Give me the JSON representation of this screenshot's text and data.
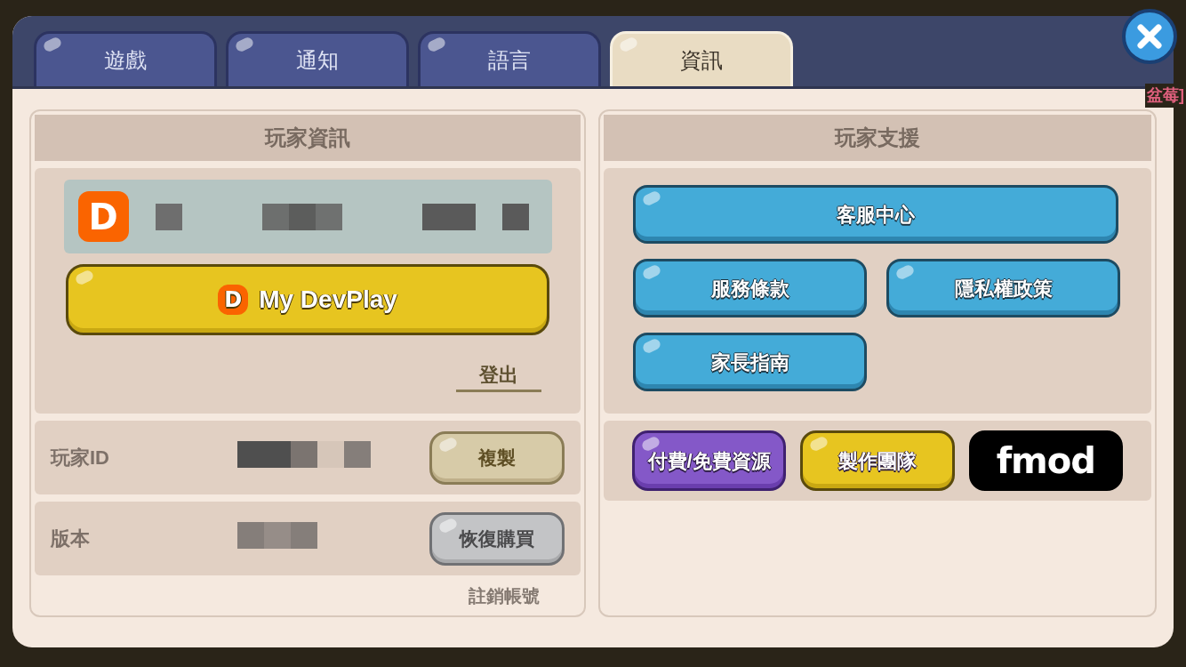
{
  "tabs": [
    {
      "label": "遊戲",
      "selected": false
    },
    {
      "label": "通知",
      "selected": false
    },
    {
      "label": "語言",
      "selected": false
    },
    {
      "label": "資訊",
      "selected": true
    }
  ],
  "background_text": "盆莓]",
  "player_info": {
    "title": "玩家資訊",
    "logo_letter": "D",
    "button_logo_letter": "D",
    "account_button": "My DevPlay",
    "logout": "登出",
    "rows": [
      {
        "label": "玩家ID",
        "button": "複製",
        "kind": "tan"
      },
      {
        "label": "版本",
        "button": "恢復購買",
        "kind": "gray"
      }
    ],
    "delete_account": "註銷帳號"
  },
  "player_support": {
    "title": "玩家支援",
    "links": [
      "客服中心",
      "服務條款",
      "隱私權政策",
      "家長指南"
    ],
    "credits": [
      {
        "label": "付費/免費資源",
        "kind": "purple"
      },
      {
        "label": "製作團隊",
        "kind": "yellow"
      },
      {
        "label": "fmod",
        "kind": "logo"
      }
    ]
  }
}
